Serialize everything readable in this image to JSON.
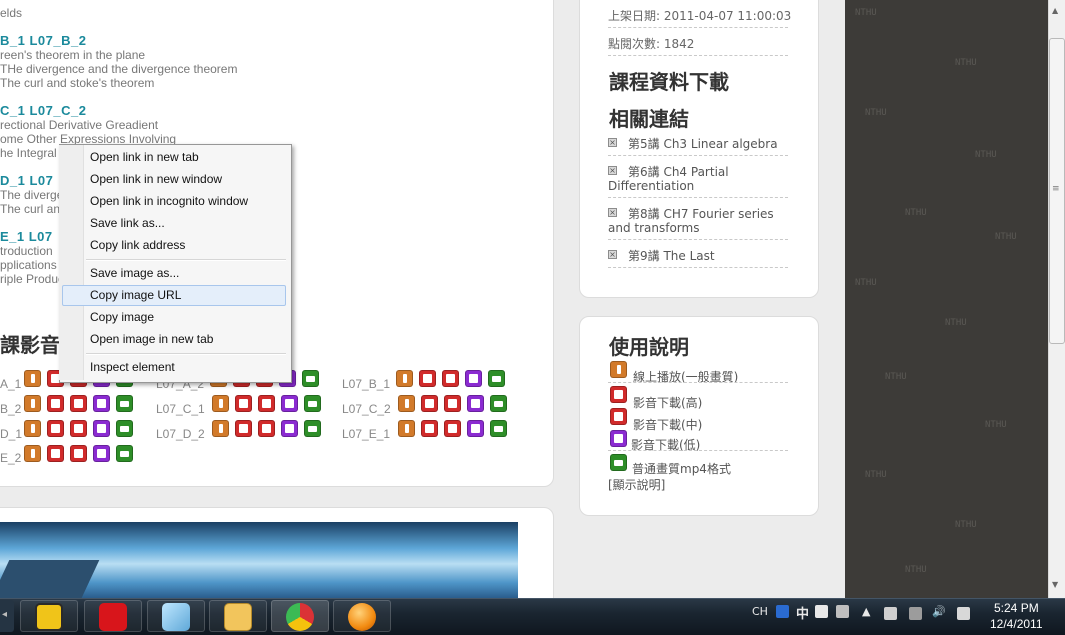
{
  "main": {
    "fields_fragment": "elds",
    "lectures": [
      {
        "title": "B_1  L07_B_2",
        "items": [
          "reen's theorem in the plane",
          "THe divergence and the divergence theorem",
          "The curl and stoke's theorem"
        ]
      },
      {
        "title": "C_1  L07_C_2",
        "items": [
          "rectional Derivative Greadient",
          "ome Other Expressions Involving",
          "he Integral"
        ]
      },
      {
        "title": "D_1  L07",
        "items": [
          "The diverge",
          "The curl an"
        ]
      },
      {
        "title": "E_1  L07",
        "items": [
          "troduction",
          "pplications",
          "riple Produc"
        ]
      }
    ],
    "video_section_title": "課影音",
    "video_rows": [
      {
        "left": "A_1",
        "mid": "L07_A_2",
        "right": "L07_B_1"
      },
      {
        "left": "B_2",
        "mid": "L07_C_1",
        "right": "L07_C_2"
      },
      {
        "left": "D_1",
        "mid": "L07_D_2",
        "right": "L07_E_1"
      },
      {
        "left": "E_2",
        "mid": "",
        "right": ""
      }
    ]
  },
  "info": {
    "upload_date": "上架日期: 2011-04-07 11:00:03",
    "view_count": "點閱次數: 1842",
    "download_heading": "課程資料下載",
    "related_heading": "相關連結",
    "related_links": [
      "第5講  Ch3 Linear algebra",
      "第6講       Ch4       Partial Differentiation",
      "第8講  CH7 Fourier series and transforms",
      "第9講  The Last"
    ]
  },
  "help": {
    "heading": "使用說明",
    "items": [
      "線上播放(一般畫質)",
      "影音下載(高)",
      "影音下載(中)",
      "影音下載(低)",
      "普通畫質mp4格式"
    ],
    "explain_link": "[顯示說明]"
  },
  "context_menu": {
    "items": [
      "Open link in new tab",
      "Open link in new window",
      "Open link in incognito window",
      "Save link as...",
      "Copy link address",
      "Save image as...",
      "Copy image URL",
      "Copy image",
      "Open image in new tab",
      "Inspect element"
    ],
    "highlighted": "Copy image URL"
  },
  "background_pattern": {
    "words": [
      "NTHU"
    ]
  },
  "taskbar": {
    "apps": [
      "norton-icon",
      "avira-icon",
      "notes-icon",
      "mail-icon",
      "chrome-icon",
      "media-player-icon"
    ],
    "input_lang": "CH",
    "ime_char": "中",
    "clock_time": "5:24 PM",
    "clock_date": "12/4/2011"
  },
  "colors": {
    "link_teal": "#1b8a9c",
    "icon_orange": "#d27a2a",
    "icon_red": "#d12b2b",
    "icon_purple": "#8b2bd1",
    "icon_green": "#2e8e28"
  }
}
